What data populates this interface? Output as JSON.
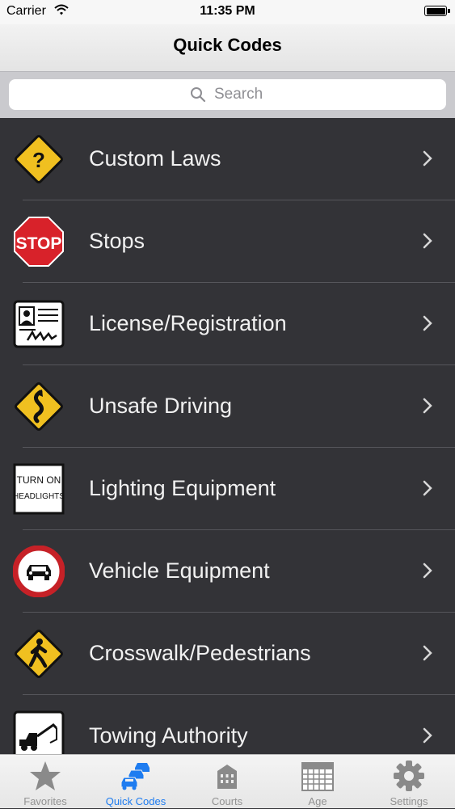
{
  "status": {
    "carrier": "Carrier",
    "time": "11:35 PM"
  },
  "nav": {
    "title": "Quick Codes"
  },
  "search": {
    "placeholder": "Search"
  },
  "rows": [
    {
      "label": "Custom Laws",
      "icon": "question-diamond-sign-icon"
    },
    {
      "label": "Stops",
      "icon": "stop-sign-icon",
      "sign_text": "STOP"
    },
    {
      "label": "License/Registration",
      "icon": "license-card-icon"
    },
    {
      "label": "Unsafe Driving",
      "icon": "winding-road-sign-icon"
    },
    {
      "label": "Lighting Equipment",
      "icon": "turn-on-headlights-sign-icon",
      "sign_text": [
        "TURN ON",
        "HEADLIGHTS"
      ]
    },
    {
      "label": "Vehicle Equipment",
      "icon": "no-vehicles-sign-icon"
    },
    {
      "label": "Crosswalk/Pedestrians",
      "icon": "pedestrian-crossing-sign-icon"
    },
    {
      "label": "Towing Authority",
      "icon": "tow-truck-sign-icon"
    }
  ],
  "tabs": [
    {
      "label": "Favorites",
      "icon": "star-icon",
      "active": false
    },
    {
      "label": "Quick Codes",
      "icon": "cars-icon",
      "active": true
    },
    {
      "label": "Courts",
      "icon": "courthouse-icon",
      "active": false
    },
    {
      "label": "Age",
      "icon": "calendar-icon",
      "active": false
    },
    {
      "label": "Settings",
      "icon": "gear-icon",
      "active": false
    }
  ],
  "colors": {
    "list_bg": "#333337",
    "active_tab": "#1e7cf0",
    "inactive_tab": "#929292",
    "sign_yellow": "#f0c020",
    "stop_red": "#d8222a"
  }
}
